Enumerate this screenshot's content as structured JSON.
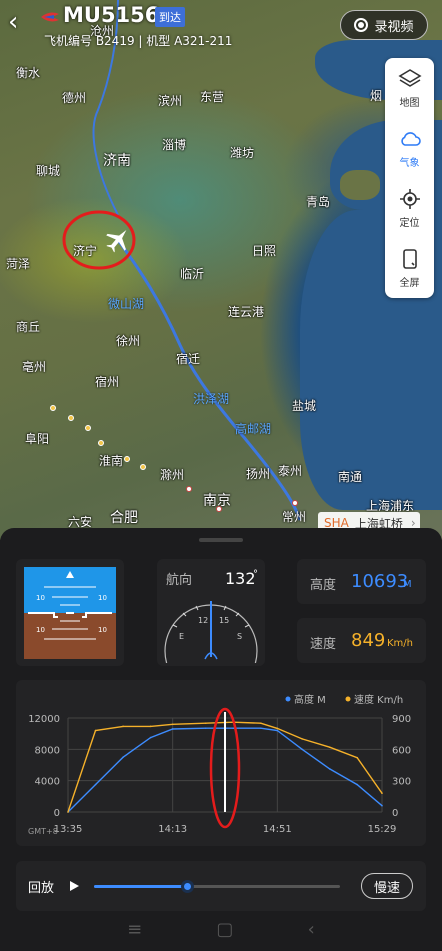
{
  "header": {
    "flight_no": "MU5156",
    "status_badge": "到达",
    "subtitle": "飞机编号 B2419 | 机型 A321-211",
    "record_label": "录视频"
  },
  "tools": [
    {
      "label": "地图",
      "icon": "layers-icon"
    },
    {
      "label": "气象",
      "icon": "cloud-icon"
    },
    {
      "label": "定位",
      "icon": "locate-icon"
    },
    {
      "label": "全屏",
      "icon": "fullscreen-icon"
    }
  ],
  "map": {
    "places": [
      "沧州",
      "衡水",
      "德州",
      "滨州",
      "东营",
      "烟",
      "济南",
      "淄博",
      "潍坊",
      "聊城",
      "青岛",
      "济宁",
      "菏泽",
      "临沂",
      "日照",
      "微山湖",
      "商丘",
      "徐州",
      "连云港",
      "亳州",
      "宿州",
      "宿迁",
      "洪泽湖",
      "盐城",
      "阜阳",
      "高邮湖",
      "淮南",
      "滁州",
      "扬州",
      "泰州",
      "南通",
      "南京",
      "六安",
      "合肥",
      "常州",
      "上海浦东"
    ],
    "destination_code": "SHA",
    "destination_name": "上海虹桥"
  },
  "attitude": {
    "pitch_labels": [
      "10",
      "10",
      "10",
      "10"
    ]
  },
  "heading": {
    "label": "航向",
    "value": "132",
    "unit": "°",
    "dial": [
      "E",
      "12",
      "15",
      "S"
    ]
  },
  "altitude": {
    "label": "高度",
    "value": "10693",
    "unit": "M"
  },
  "speed": {
    "label": "速度",
    "value": "849",
    "unit": "Km/h"
  },
  "chart_data": {
    "type": "line",
    "legend_placement": "top-right",
    "series": [
      {
        "name": "高度 M",
        "color": "#3d8cff",
        "axis": "left",
        "x": [
          "13:35",
          "13:45",
          "13:55",
          "14:05",
          "14:13",
          "14:25",
          "14:35",
          "14:45",
          "14:51",
          "15:00",
          "15:10",
          "15:20",
          "15:29"
        ],
        "values": [
          0,
          3500,
          7000,
          9500,
          10600,
          10700,
          10700,
          10700,
          10400,
          8000,
          5500,
          3500,
          800
        ]
      },
      {
        "name": "速度 Km/h",
        "color": "#f5b12a",
        "axis": "right",
        "x": [
          "13:35",
          "13:45",
          "13:55",
          "14:05",
          "14:13",
          "14:25",
          "14:35",
          "14:45",
          "14:51",
          "15:00",
          "15:10",
          "15:20",
          "15:29"
        ],
        "values": [
          0,
          780,
          820,
          820,
          840,
          850,
          860,
          850,
          800,
          700,
          620,
          520,
          180
        ]
      }
    ],
    "y_left": {
      "ticks": [
        "12000",
        "8000",
        "4000",
        "0"
      ],
      "range": [
        0,
        12000
      ]
    },
    "y_right": {
      "ticks": [
        "900",
        "600",
        "300",
        "0"
      ],
      "range": [
        0,
        900
      ]
    },
    "x_ticks": [
      "13:35",
      "14:13",
      "14:51",
      "15:29"
    ],
    "tz": "GMT+8",
    "cursor_time": "14:32",
    "grid": true
  },
  "playback": {
    "label": "回放",
    "progress": 0.38,
    "speed_label": "慢速"
  }
}
